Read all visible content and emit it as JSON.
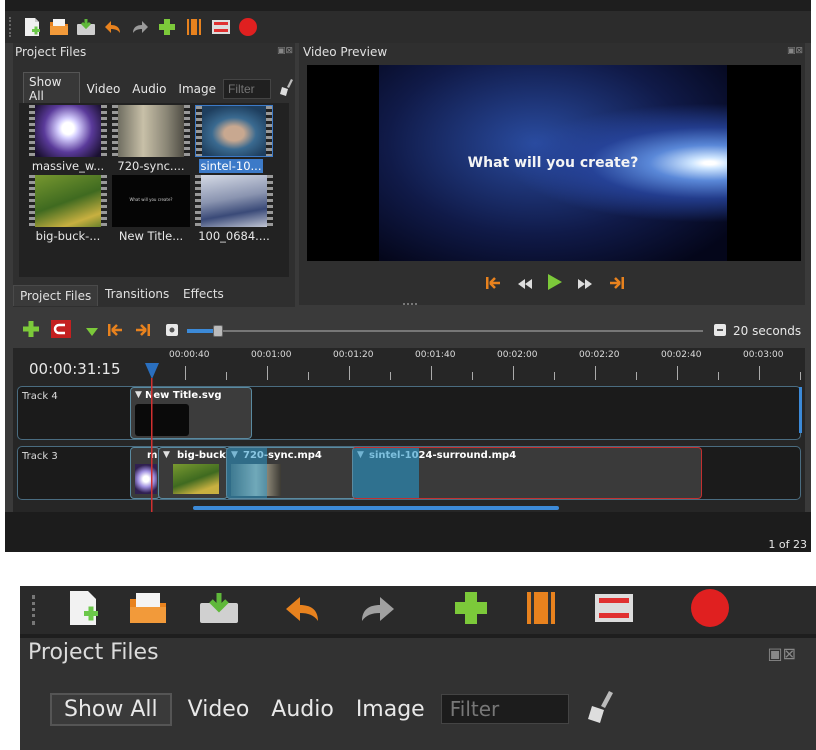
{
  "toolbar": {
    "icons": [
      "new-project-icon",
      "open-project-icon",
      "save-project-icon",
      "undo-icon",
      "redo-icon",
      "import-files-icon",
      "profile-icon",
      "fullscreen-icon",
      "export-video-icon"
    ]
  },
  "project_files": {
    "title": "Project Files",
    "filters": [
      "Show All",
      "Video",
      "Audio",
      "Image"
    ],
    "filter_placeholder": "Filter",
    "files": [
      {
        "name": "massive_w...",
        "selected": false
      },
      {
        "name": "720-sync....",
        "selected": false
      },
      {
        "name": "sintel-10...",
        "selected": true
      },
      {
        "name": "big-buck-...",
        "selected": false
      },
      {
        "name": "New Title...",
        "selected": false
      },
      {
        "name": "100_0684....",
        "selected": false
      }
    ],
    "title_thumb_text": "What will you create?"
  },
  "video_preview": {
    "title": "Video Preview",
    "frame_text": "What will you create?"
  },
  "bottom_tabs": [
    "Project Files",
    "Transitions",
    "Effects"
  ],
  "timeline": {
    "zoom_label": "20 seconds",
    "zoom_fraction": 0.06,
    "current_time": "00:00:31:15",
    "ruler": [
      "00:00:40",
      "00:01:00",
      "00:01:20",
      "00:01:40",
      "00:02:00",
      "00:02:20",
      "00:02:40",
      "00:03:00"
    ],
    "tracks": [
      {
        "name": "Track 4",
        "clips": [
          "New Title.svg"
        ]
      },
      {
        "name": "Track 3",
        "clips": [
          "m",
          "big-buck-",
          "720-sync.mp4",
          "sintel-1024-surround.mp4"
        ]
      }
    ]
  },
  "page_indicator": "1 of 23",
  "colors": {
    "accent": "#3c7ac8",
    "playhead": "#2a6fbf",
    "orange": "#e8821e",
    "green": "#7cc93a",
    "record": "#e02020"
  }
}
